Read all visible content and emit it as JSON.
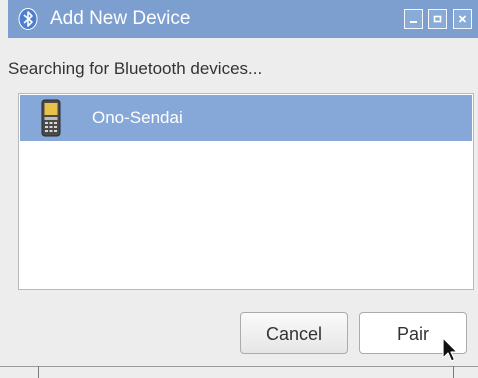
{
  "window": {
    "title": "Add New Device",
    "icon": "bluetooth-icon",
    "controls": [
      {
        "name": "minimize-icon"
      },
      {
        "name": "maximize-icon"
      },
      {
        "name": "close-icon"
      }
    ]
  },
  "status_text": "Searching for Bluetooth devices...",
  "devices": [
    {
      "name": "Ono-Sendai",
      "icon": "mobile-phone-icon",
      "selected": true
    }
  ],
  "buttons": {
    "cancel": "Cancel",
    "pair": "Pair"
  },
  "colors": {
    "titlebar": "#7c9fd0",
    "selection": "#86a8d8",
    "window_bg": "#ededed"
  }
}
